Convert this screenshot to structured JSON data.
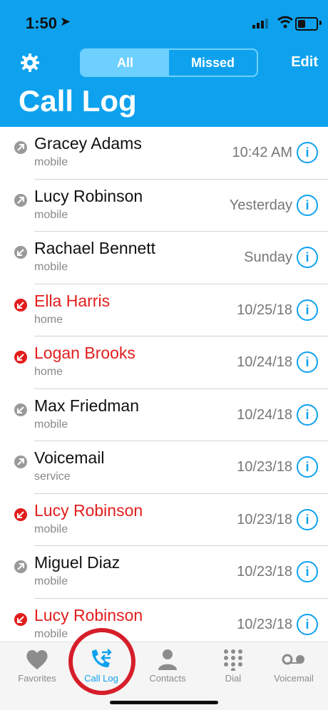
{
  "status": {
    "time": "1:50"
  },
  "header": {
    "segments": [
      "All",
      "Missed"
    ],
    "edit_label": "Edit",
    "title": "Call Log"
  },
  "calls": [
    {
      "name": "Gracey Adams",
      "type": "mobile",
      "time": "10:42 AM",
      "status": "outgoing"
    },
    {
      "name": "Lucy Robinson",
      "type": "mobile",
      "time": "Yesterday",
      "status": "outgoing"
    },
    {
      "name": "Rachael Bennett",
      "type": "mobile",
      "time": "Sunday",
      "status": "incoming"
    },
    {
      "name": "Ella Harris",
      "type": "home",
      "time": "10/25/18",
      "status": "missed"
    },
    {
      "name": "Logan Brooks",
      "type": "home",
      "time": "10/24/18",
      "status": "missed"
    },
    {
      "name": "Max Friedman",
      "type": "mobile",
      "time": "10/24/18",
      "status": "incoming"
    },
    {
      "name": "Voicemail",
      "type": "service",
      "time": "10/23/18",
      "status": "outgoing"
    },
    {
      "name": "Lucy Robinson",
      "type": "mobile",
      "time": "10/23/18",
      "status": "missed"
    },
    {
      "name": "Miguel Diaz",
      "type": "mobile",
      "time": "10/23/18",
      "status": "outgoing"
    },
    {
      "name": "Lucy Robinson",
      "type": "mobile",
      "time": "10/23/18",
      "status": "missed"
    }
  ],
  "tabs": [
    {
      "label": "Favorites",
      "icon": "heart-icon"
    },
    {
      "label": "Call Log",
      "icon": "call-log-icon"
    },
    {
      "label": "Contacts",
      "icon": "person-icon"
    },
    {
      "label": "Dial",
      "icon": "keypad-icon"
    },
    {
      "label": "Voicemail",
      "icon": "voicemail-icon"
    }
  ],
  "colors": {
    "accent": "#0ea2ee",
    "missed": "#e21d1d",
    "muted": "#8c8c8c"
  }
}
